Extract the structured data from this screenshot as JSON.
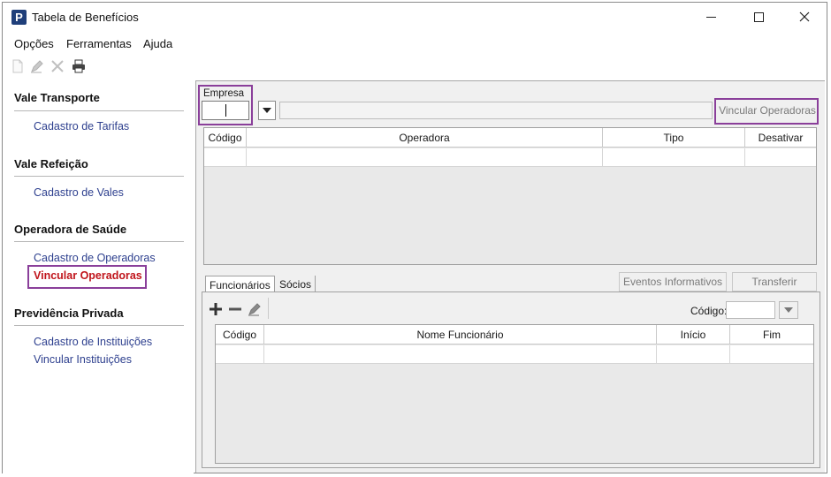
{
  "window": {
    "title": "Tabela de Benefícios",
    "icon_letter": "P"
  },
  "menu": [
    {
      "label": "Opções"
    },
    {
      "label": "Ferramentas"
    },
    {
      "label": "Ajuda"
    }
  ],
  "toolbar": {
    "icons": [
      "new-document-icon",
      "edit-pencil-icon",
      "delete-x-icon",
      "print-icon"
    ]
  },
  "nav": {
    "sections": [
      {
        "title": "Vale Transporte",
        "links": [
          "Cadastro de Tarifas"
        ]
      },
      {
        "title": "Vale Refeição",
        "links": [
          "Cadastro de Vales"
        ]
      },
      {
        "title": "Operadora de Saúde",
        "links": [
          "Cadastro de Operadoras",
          "Vincular Operadoras"
        ]
      },
      {
        "title": "Previdência Privada",
        "links": [
          "Cadastro de Instituições",
          "Vincular Instituições"
        ]
      }
    ],
    "active_link": "Vincular Operadoras"
  },
  "main": {
    "empresa_label": "Empresa",
    "empresa_value": "",
    "empresa_description": "",
    "vincular_button": "Vincular Operadoras",
    "operadoras_table": {
      "columns": [
        "Código",
        "Operadora",
        "Tipo",
        "Desativar"
      ],
      "rows": []
    },
    "tabs": [
      {
        "label": "Funcionários",
        "active": true
      },
      {
        "label": "Sócios",
        "active": false
      }
    ],
    "eventos_button": "Eventos Informativos",
    "transferir_button": "Transferir",
    "codigo_label": "Código:",
    "codigo_value": "",
    "funcionarios_table": {
      "columns": [
        "Código",
        "Nome Funcionário",
        "Início",
        "Fim"
      ],
      "rows": []
    }
  },
  "colors": {
    "highlight": "#8a3f9a",
    "active_link": "#c0141b",
    "link": "#2d3f8e",
    "disabled_text": "#7a7a7a",
    "app_icon": "#1f3f7a"
  }
}
